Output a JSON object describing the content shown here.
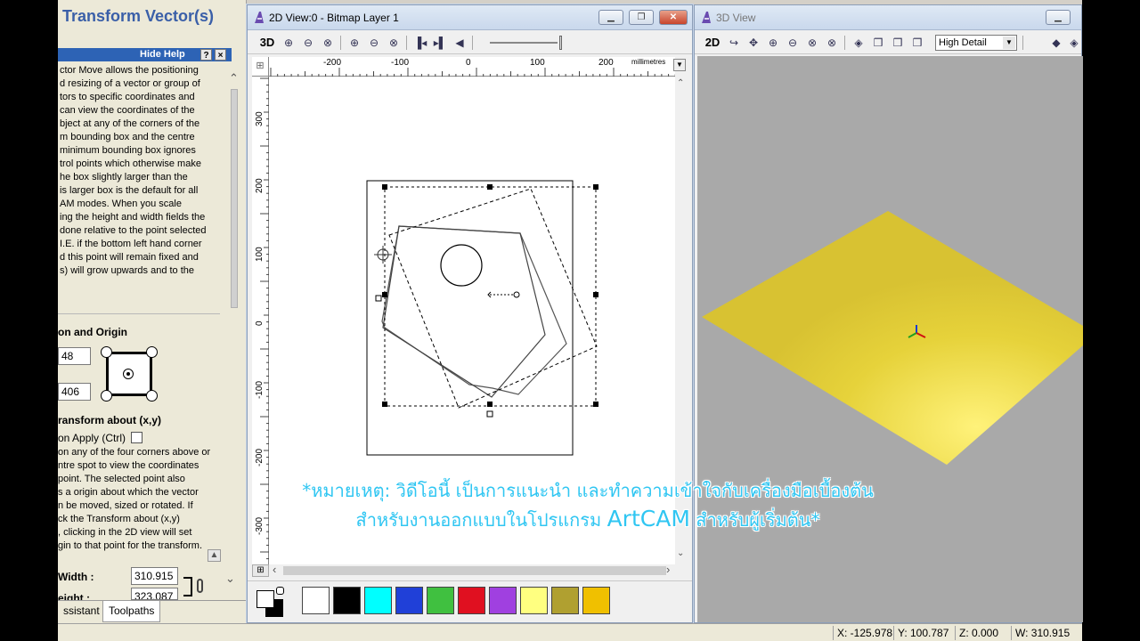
{
  "left_panel": {
    "title": "Transform Vector(s)",
    "hide_help": "Hide Help",
    "help_icon": "?",
    "close_icon": "×",
    "help_lines": [
      "ctor Move allows the positioning",
      "d resizing of a vector or group of",
      "tors to specific coordinates and",
      "can view the coordinates of the",
      "bject at any of the corners of the",
      "m bounding box and the centre",
      " minimum bounding box ignores",
      "trol points which otherwise make",
      "he box slightly larger than the",
      "is larger box is the default for all",
      "AM modes. When you scale",
      "ing the height and width fields the",
      "done relative to the point selected",
      " I.E. if the bottom left hand corner",
      "d this point will remain fixed and",
      "s) will grow upwards and to the"
    ],
    "section_position": "on and Origin",
    "x_value": "48",
    "y_value": "406",
    "section_transform": "ransform about (x,y)",
    "on_apply_label": "on Apply (Ctrl)",
    "transform_lines": [
      "on any of the four corners above or",
      "ntre spot to view the coordinates",
      " point. The selected point also",
      "s a origin about which the vector",
      "n be moved, sized or rotated. If",
      "ck the Transform about (x,y)",
      ", clicking in the 2D view will set",
      "gin to that point for the transform."
    ],
    "width_label": "Width :",
    "width_value": "310.915",
    "height_label": "eight :",
    "height_value": "323.087",
    "tabs": [
      "ssistant",
      "Toolpaths"
    ]
  },
  "win2d": {
    "title": "2D View:0 - Bitmap Layer 1",
    "btn_3d": "3D",
    "ruler_units": "millimetres",
    "h_ticks": [
      "-200",
      "-100",
      "0",
      "100",
      "200"
    ],
    "v_ticks": [
      "300",
      "200",
      "100",
      "0",
      "-100",
      "-200",
      "-300"
    ],
    "palette_colors": [
      "#ffffff",
      "#000000",
      "#00ffff",
      "#2040d8",
      "#40c040",
      "#e01020",
      "#a040e0",
      "#ffff80",
      "#b0a030",
      "#f0c000"
    ]
  },
  "win3d": {
    "title": "3D View",
    "btn_2d": "2D",
    "detail_select": "High Detail",
    "plane_color": "#e8d53a",
    "background": "#a9a9a9"
  },
  "status": {
    "x": "X: -125.978",
    "y": "Y: 100.787",
    "z": "Z: 0.000",
    "w": "W: 310.915"
  },
  "subtitle": {
    "line1": "*หมายเหตุ: วิดีโอนี้ เป็นการแนะนำ และทำความเข้าใจกับเครื่องมือเบื้องต้น",
    "line2_a": "สำหรับงานออกแบบในโปรแกรม ",
    "line2_b": "ArtCAM",
    "line2_c": " สำหรับผู้เริ่มต้น*"
  }
}
